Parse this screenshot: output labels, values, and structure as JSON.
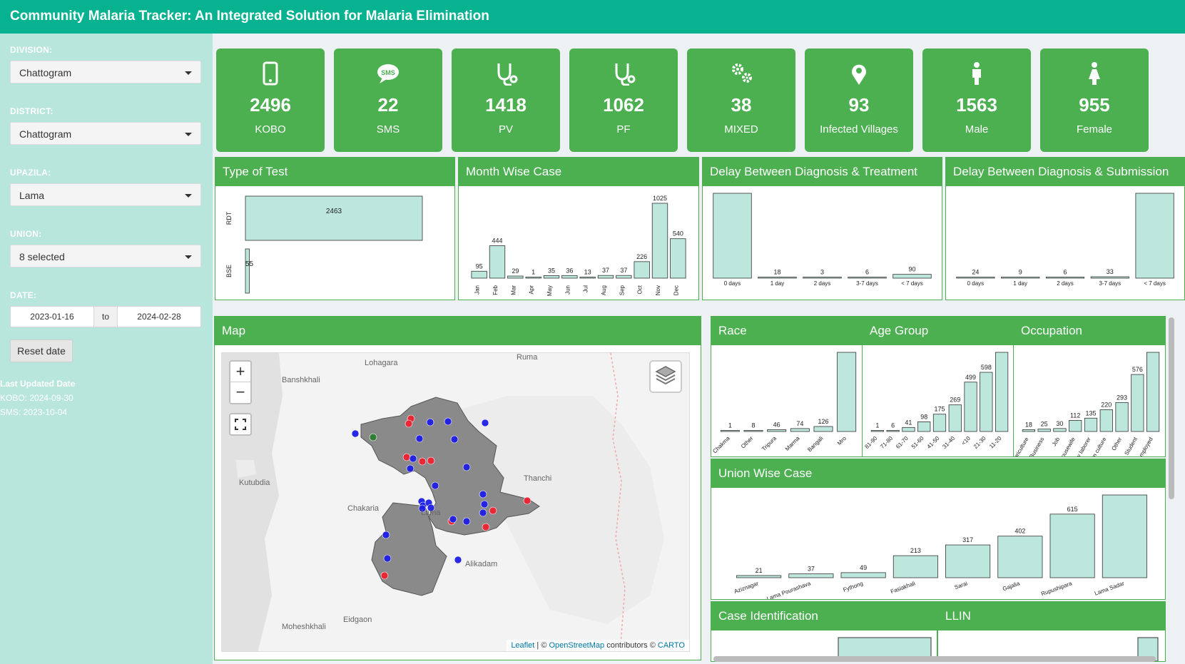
{
  "app": {
    "title": "Community Malaria Tracker: An Integrated Solution for Malaria Elimination"
  },
  "sidebar": {
    "division": {
      "label": "DIVISION:",
      "value": "Chattogram"
    },
    "district": {
      "label": "DISTRICT:",
      "value": "Chattogram"
    },
    "upazila": {
      "label": "UPAZILA:",
      "value": "Lama"
    },
    "union": {
      "label": "UNION:",
      "value": "8 selected"
    },
    "date": {
      "label": "DATE:",
      "start": "2023-01-16",
      "to": "to",
      "end": "2024-02-28"
    },
    "reset_label": "Reset date",
    "updated": {
      "title": "Last Updated Date",
      "kobo": "KOBO: 2024-09-30",
      "sms": "SMS: 2023-10-04"
    }
  },
  "kpis": [
    {
      "value": "2496",
      "label": "KOBO",
      "icon": "mobile-phone-icon"
    },
    {
      "value": "22",
      "label": "SMS",
      "icon": "sms-bubble-icon"
    },
    {
      "value": "1418",
      "label": "PV",
      "icon": "stethoscope-icon"
    },
    {
      "value": "1062",
      "label": "PF",
      "icon": "stethoscope-icon"
    },
    {
      "value": "38",
      "label": "MIXED",
      "icon": "gears-icon"
    },
    {
      "value": "93",
      "label": "Infected Villages",
      "icon": "map-marker-icon"
    },
    {
      "value": "1563",
      "label": "Male",
      "icon": "male-icon"
    },
    {
      "value": "955",
      "label": "Female",
      "icon": "female-icon"
    }
  ],
  "panels": {
    "type_of_test": "Type of Test",
    "month_wise": "Month Wise Case",
    "delay_treatment": "Delay Between Diagnosis & Treatment",
    "delay_submission": "Delay Between Diagnosis & Submission",
    "map": "Map",
    "race": "Race",
    "age_group": "Age Group",
    "occupation": "Occupation",
    "union_wise": "Union Wise Case",
    "case_identification": "Case Identification",
    "llin": "LLIN"
  },
  "map": {
    "place_labels": [
      "Lohagara",
      "Ruma",
      "Banshkhali",
      "Kutubdia",
      "Thanchi",
      "Chakaria",
      "Lama",
      "Alikadam",
      "Eidgaon",
      "Moheshkhali"
    ],
    "zoom_in": "+",
    "zoom_out": "−",
    "attribution": {
      "leaflet": "Leaflet",
      "sep": " | © ",
      "osm": "OpenStreetMap",
      "contrib": " contributors © ",
      "carto": "CARTO"
    },
    "colors": {
      "area": "#8a8a8a",
      "blue": "#1e1ee6",
      "red": "#ee2233",
      "green": "#2e7d32"
    }
  },
  "colors": {
    "header": "#07b290",
    "sidebar": "#b8e6dd",
    "kpi": "#4caf50",
    "bar_fill": "#bde6dd",
    "bar_stroke": "#333333"
  },
  "chart_data": [
    {
      "id": "type_of_test",
      "type": "bar",
      "orientation": "horizontal",
      "categories": [
        "RDT",
        "BSE"
      ],
      "values": [
        2463,
        55
      ]
    },
    {
      "id": "month_wise",
      "type": "bar",
      "categories": [
        "Jan",
        "Feb",
        "Mar",
        "Apr",
        "May",
        "Jun",
        "Jul",
        "Aug",
        "Sep",
        "Oct",
        "Nov",
        "Dec"
      ],
      "values": [
        95,
        444,
        29,
        1,
        35,
        36,
        13,
        37,
        37,
        226,
        1025,
        540
      ]
    },
    {
      "id": "delay_treatment",
      "type": "bar",
      "categories": [
        "0 days",
        "1 day",
        "2 days",
        "3-7 days",
        "< 7 days"
      ],
      "values": [
        2000,
        18,
        3,
        6,
        90
      ],
      "value_labels": [
        "",
        "18",
        "3",
        "6",
        "90"
      ]
    },
    {
      "id": "delay_submission",
      "type": "bar",
      "categories": [
        "0 days",
        "1 day",
        "2 days",
        "3-7 days",
        "< 7 days"
      ],
      "values": [
        24,
        9,
        6,
        33,
        2000
      ],
      "value_labels": [
        "24",
        "9",
        "6",
        "33",
        ""
      ]
    },
    {
      "id": "race",
      "type": "bar",
      "categories": [
        "Chakma",
        "Other",
        "Tripura",
        "Marma",
        "Bangali",
        "Mro"
      ],
      "values": [
        1,
        8,
        46,
        74,
        126,
        2000
      ],
      "value_labels": [
        "1",
        "8",
        "46",
        "74",
        "126",
        ""
      ]
    },
    {
      "id": "age_group",
      "type": "bar",
      "categories": [
        "81-90",
        "71-80",
        "61-70",
        "51-60",
        "41-50",
        "31-40",
        "<10",
        "21-30",
        "11-20"
      ],
      "values": [
        1,
        6,
        41,
        98,
        175,
        269,
        499,
        598,
        800
      ],
      "value_labels": [
        "1",
        "6",
        "41",
        "98",
        "175",
        "269",
        "499",
        "598",
        ""
      ]
    },
    {
      "id": "occupation",
      "type": "bar",
      "categories": [
        "Agriculture",
        "Business",
        "Job",
        "Housewife",
        "Day laborer",
        "Jhum culture",
        "Other",
        "Student",
        "Unemployed"
      ],
      "values": [
        18,
        25,
        30,
        112,
        135,
        220,
        293,
        576,
        800
      ],
      "value_labels": [
        "18",
        "25",
        "30",
        "112",
        "135",
        "220",
        "293",
        "576",
        ""
      ]
    },
    {
      "id": "union_wise",
      "type": "bar",
      "categories": [
        "Aziznagar",
        "Lama Pourashava",
        "Fythong",
        "Fasiakhali",
        "Sarai",
        "Gajalia",
        "Rupushipara",
        "Lama Sadar"
      ],
      "values": [
        21,
        37,
        49,
        213,
        317,
        402,
        615,
        800
      ],
      "value_labels": [
        "21",
        "37",
        "49",
        "213",
        "317",
        "402",
        "615",
        ""
      ]
    }
  ]
}
